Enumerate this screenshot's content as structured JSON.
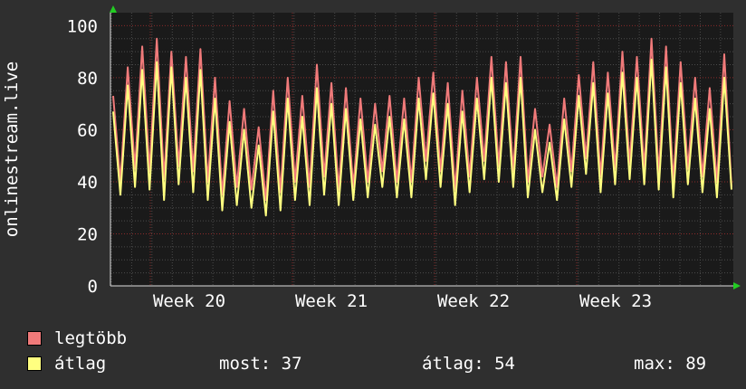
{
  "chart_data": {
    "type": "line",
    "ylabel": "onlinestream.live",
    "ylim": [
      0,
      105
    ],
    "yticks": [
      0,
      20,
      40,
      60,
      80,
      100
    ],
    "x_labels": [
      "Week 20",
      "Week 21",
      "Week 22",
      "Week 23"
    ],
    "grid": true,
    "legend_placement": "bottom-left",
    "series": [
      {
        "name": "legtöbb",
        "color": "#f07a7a",
        "values": [
          73,
          40,
          84,
          45,
          92,
          44,
          95,
          41,
          90,
          46,
          88,
          44,
          91,
          40,
          80,
          35,
          71,
          38,
          68,
          37,
          61,
          33,
          75,
          36,
          80,
          40,
          73,
          38,
          85,
          42,
          78,
          37,
          76,
          38,
          72,
          40,
          70,
          44,
          73,
          40,
          72,
          40,
          80,
          48,
          82,
          44,
          78,
          37,
          75,
          42,
          80,
          48,
          88,
          46,
          86,
          44,
          88,
          40,
          68,
          42,
          62,
          38,
          72,
          44,
          81,
          49,
          86,
          42,
          82,
          45,
          90,
          47,
          88,
          45,
          95,
          43,
          92,
          40,
          86,
          45,
          80,
          42,
          76,
          40,
          89,
          38
        ]
      },
      {
        "name": "átlag",
        "color": "#ffff80",
        "values": [
          67,
          35,
          77,
          38,
          83,
          37,
          86,
          33,
          84,
          39,
          80,
          36,
          83,
          33,
          72,
          29,
          63,
          31,
          60,
          30,
          54,
          27,
          67,
          29,
          72,
          33,
          65,
          31,
          76,
          35,
          70,
          31,
          68,
          33,
          64,
          34,
          62,
          38,
          65,
          34,
          64,
          34,
          72,
          41,
          74,
          38,
          70,
          31,
          67,
          36,
          72,
          41,
          80,
          40,
          78,
          38,
          80,
          34,
          60,
          36,
          55,
          33,
          64,
          38,
          73,
          43,
          78,
          36,
          74,
          39,
          82,
          41,
          80,
          39,
          87,
          37,
          84,
          34,
          78,
          39,
          72,
          36,
          68,
          34,
          80,
          37
        ]
      }
    ]
  },
  "legend": {
    "max_label": "legtöbb",
    "avg_label": "átlag"
  },
  "stats": {
    "now": "most: 37",
    "avg": "átlag: 54",
    "max": "max: 89"
  },
  "colors": {
    "background": "#2f2f2f",
    "plot_background": "#1a1a1a",
    "grid_major": "#8b2a2a",
    "grid_minor": "#4a4a4a",
    "axis_arrow": "#22cc22"
  }
}
